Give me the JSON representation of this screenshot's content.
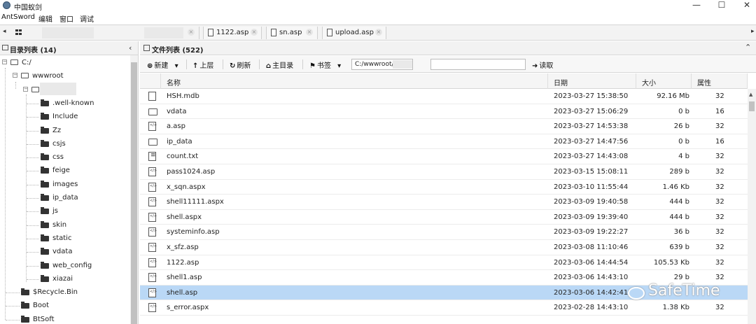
{
  "window": {
    "title": "中国蚁剑",
    "controls": {
      "minimize": "—",
      "maximize": "☐",
      "close": "✕"
    }
  },
  "menubar": {
    "items": [
      "AntSword",
      "编辑",
      "窗口",
      "调试"
    ]
  },
  "tabstrip": {
    "left_arrow": "◂",
    "right_arrow": "▸",
    "tabs": [
      {
        "label": "1122.asp",
        "close": "×"
      },
      {
        "label": "sn.asp",
        "close": "×"
      },
      {
        "label": "upload.asp",
        "close": "×"
      }
    ],
    "blurred_tab_close": "×"
  },
  "left_panel": {
    "header": "目录列表 (14)",
    "collapse_arrow": "‹",
    "tree": [
      {
        "label": "C:/",
        "expander": "−"
      },
      {
        "label": "wwwroot",
        "expander": "−"
      },
      {
        "label": "",
        "expander": "−"
      },
      {
        "label": ".well-known"
      },
      {
        "label": "Include"
      },
      {
        "label": "Zz"
      },
      {
        "label": "csjs"
      },
      {
        "label": "css"
      },
      {
        "label": "feige"
      },
      {
        "label": "images"
      },
      {
        "label": "ip_data"
      },
      {
        "label": "js"
      },
      {
        "label": "skin"
      },
      {
        "label": "static"
      },
      {
        "label": "vdata"
      },
      {
        "label": "web_config"
      },
      {
        "label": "xiazai"
      },
      {
        "label": "$Recycle.Bin"
      },
      {
        "label": "Boot"
      },
      {
        "label": "BtSoft"
      }
    ]
  },
  "right_panel": {
    "header": "文件列表 (522)",
    "collapse_arrow": "⌃",
    "toolbar": {
      "new": {
        "icon": "⊕",
        "label": "新建",
        "dropdown": "▾"
      },
      "up": {
        "icon": "↑",
        "label": "上层"
      },
      "refresh": {
        "icon": "↻",
        "label": "刷新"
      },
      "home": {
        "icon": "⌂",
        "label": "主目录"
      },
      "bookmark": {
        "icon": "⚑",
        "label": "书签",
        "dropdown": "▾"
      },
      "path_value": "C:/wwwroot/",
      "read": {
        "icon": "➜",
        "label": "读取"
      }
    },
    "columns": {
      "name": "名称",
      "date": "日期",
      "size": "大小",
      "attr": "属性"
    },
    "files": [
      {
        "icon": "file",
        "name": "HSH.mdb",
        "date": "2023-03-27 15:38:50",
        "size": "92.16 Mb",
        "attr": "32"
      },
      {
        "icon": "folder",
        "name": "vdata",
        "date": "2023-03-27 15:06:29",
        "size": "0 b",
        "attr": "16"
      },
      {
        "icon": "code",
        "name": "a.asp",
        "date": "2023-03-27 14:53:38",
        "size": "26 b",
        "attr": "32"
      },
      {
        "icon": "folder",
        "name": "ip_data",
        "date": "2023-03-27 14:47:56",
        "size": "0 b",
        "attr": "16"
      },
      {
        "icon": "text",
        "name": "count.txt",
        "date": "2023-03-27 14:43:08",
        "size": "4 b",
        "attr": "32"
      },
      {
        "icon": "code",
        "name": "pass1024.asp",
        "date": "2023-03-15 15:08:11",
        "size": "289 b",
        "attr": "32"
      },
      {
        "icon": "code",
        "name": "x_sqn.aspx",
        "date": "2023-03-10 11:55:44",
        "size": "1.46 Kb",
        "attr": "32"
      },
      {
        "icon": "code",
        "name": "shell11111.aspx",
        "date": "2023-03-09 19:40:58",
        "size": "444 b",
        "attr": "32"
      },
      {
        "icon": "code",
        "name": "shell.aspx",
        "date": "2023-03-09 19:39:40",
        "size": "444 b",
        "attr": "32"
      },
      {
        "icon": "code",
        "name": "systeminfo.asp",
        "date": "2023-03-09 19:22:27",
        "size": "36 b",
        "attr": "32"
      },
      {
        "icon": "code",
        "name": "x_sfz.asp",
        "date": "2023-03-08 11:10:46",
        "size": "639 b",
        "attr": "32"
      },
      {
        "icon": "code",
        "name": "1122.asp",
        "date": "2023-03-06 14:44:54",
        "size": "105.53 Kb",
        "attr": "32"
      },
      {
        "icon": "code",
        "name": "shell1.asp",
        "date": "2023-03-06 14:43:10",
        "size": "29 b",
        "attr": "32"
      },
      {
        "icon": "code",
        "name": "shell.asp",
        "date": "2023-03-06 14:42:41",
        "size": "",
        "attr": "",
        "selected": true
      },
      {
        "icon": "code",
        "name": "s_error.aspx",
        "date": "2023-02-28 14:43:10",
        "size": "1.38 Kb",
        "attr": "32"
      }
    ]
  },
  "watermark": "SafeTime"
}
